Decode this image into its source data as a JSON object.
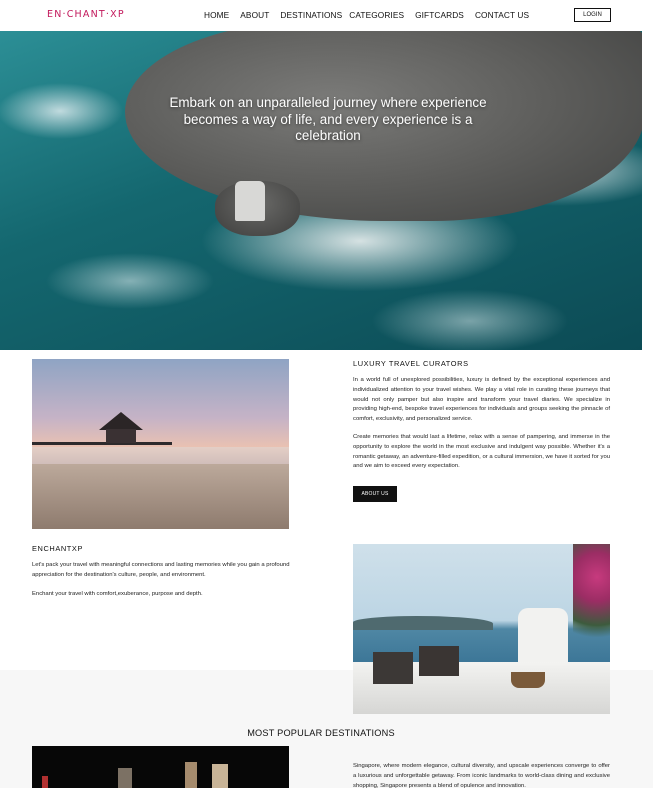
{
  "nav": {
    "logo": "EN·CHANT·XP",
    "items": [
      "HOME",
      "ABOUT",
      "DESTINATIONS",
      "CATEGORIES",
      "GIFTCARDS",
      "CONTACT US"
    ],
    "login": "LOGIN"
  },
  "hero": {
    "headline": "Embark on an unparalleled journey where experience becomes a way of life, and every experience is a celebration"
  },
  "luxury": {
    "heading": "LUXURY  TRAVEL  CURATORS",
    "paragraph1": "In a world full of unexplored possibilities, luxury is defined by the exceptional experiences and individualized attention to your travel wishes. We play a vital role in curating these journeys that would not only pamper but also inspire and transform your travel diaries. We specialize in providing high-end, bespoke travel experiences for individuals and groups seeking the pinnacle of comfort, exclusivity, and personalized service.",
    "paragraph2": "Create memories that would last a lifetime, relax with a sense of pampering, and immerse in the opportunity to explore the world in the most exclusive and indulgent way possible. Whether it's a romantic getaway, an adventure-filled expedition, or a cultural immersion, we have it sorted for you and we aim to exceed every expectation.",
    "button": "ABOUT US"
  },
  "enchant": {
    "heading": "ENCHANTXP",
    "paragraph1": "Let's pack your travel with meaningful connections and lasting memories while you gain a profound appreciation for the destination's culture, people, and environment.",
    "paragraph2": "Enchant your travel with comfort,exuberance, purpose and depth."
  },
  "popular": {
    "heading": "MOST POPULAR DESTINATIONS",
    "singapore_text": "Singapore, where modern elegance, cultural diversity, and upscale experiences converge to offer a luxurious and unforgettable getaway. From iconic landmarks to world-class dining and exclusive shopping, Singapore presents a blend of opulence and innovation."
  }
}
